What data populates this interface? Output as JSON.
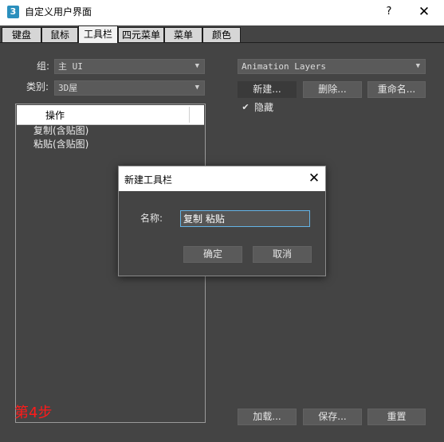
{
  "window": {
    "app_icon": "3",
    "title": "自定义用户界面",
    "help": "?",
    "close": "✕"
  },
  "tabs": [
    {
      "label": "键盘",
      "active": false
    },
    {
      "label": "鼠标",
      "active": false
    },
    {
      "label": "工具栏",
      "active": true
    },
    {
      "label": "四元菜单",
      "active": false
    },
    {
      "label": "菜单",
      "active": false
    },
    {
      "label": "颜色",
      "active": false
    }
  ],
  "left_panel": {
    "group_label": "组:",
    "group_value": "主 UI",
    "category_label": "类别:",
    "category_value": "3D屋",
    "list_header": "操作",
    "list_items": [
      "复制(含贴图)",
      "粘贴(含贴图)"
    ]
  },
  "right_panel": {
    "toolbar_value": "Animation Layers",
    "new_button": "新建...",
    "delete_button": "删除...",
    "rename_button": "重命名...",
    "hide_checked": true,
    "hide_label": "隐藏",
    "load_button": "加载...",
    "save_button": "保存...",
    "reset_button": "重置"
  },
  "annotation": {
    "step_text": "第4步",
    "color": "#ff1a1a"
  },
  "dialog": {
    "title": "新建工具栏",
    "close": "✕",
    "name_label": "名称:",
    "name_value": "复制 粘贴",
    "ok_button": "确定",
    "cancel_button": "取消"
  },
  "icons": {
    "dropdown_arrow": "▼",
    "check": "✔"
  },
  "colors": {
    "background": "#444444",
    "input_focus_border": "#64b4e6"
  }
}
